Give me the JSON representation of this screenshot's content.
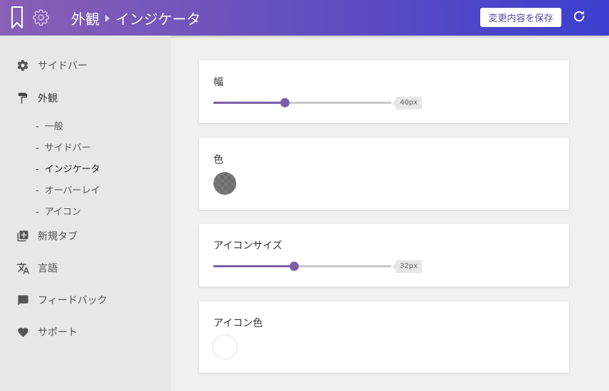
{
  "header": {
    "breadcrumb": [
      "外観",
      "インジケータ"
    ],
    "save_label": "変更内容を保存",
    "icons": {
      "bookmark": "bookmark-icon",
      "gear": "gear-icon",
      "refresh": "refresh-icon"
    }
  },
  "sidebar": {
    "items": [
      {
        "label": "サイドバー",
        "icon": "gear-icon"
      },
      {
        "label": "外観",
        "icon": "paint-roller-icon"
      },
      {
        "label": "新規タブ",
        "icon": "new-tab-icon"
      },
      {
        "label": "言語",
        "icon": "translate-icon"
      },
      {
        "label": "フィードバック",
        "icon": "chat-icon"
      },
      {
        "label": "サポート",
        "icon": "heart-icon"
      }
    ],
    "sub_items": [
      {
        "label": "一般"
      },
      {
        "label": "サイドバー"
      },
      {
        "label": "インジケータ"
      },
      {
        "label": "オーバーレイ"
      },
      {
        "label": "アイコン"
      }
    ],
    "dash": "-"
  },
  "cards": {
    "width": {
      "title": "幅",
      "value_label": "40px",
      "fraction": 0.4
    },
    "color": {
      "title": "色",
      "swatch": "checkerboard-transparent"
    },
    "icon_size": {
      "title": "アイコンサイズ",
      "value_label": "32px",
      "fraction": 0.45
    },
    "icon_color": {
      "title": "アイコン色",
      "swatch": "#ffffff"
    }
  },
  "colors": {
    "accent": "#7b5ea7",
    "header_start": "#8a5fb5",
    "header_end": "#3b3fcf"
  }
}
